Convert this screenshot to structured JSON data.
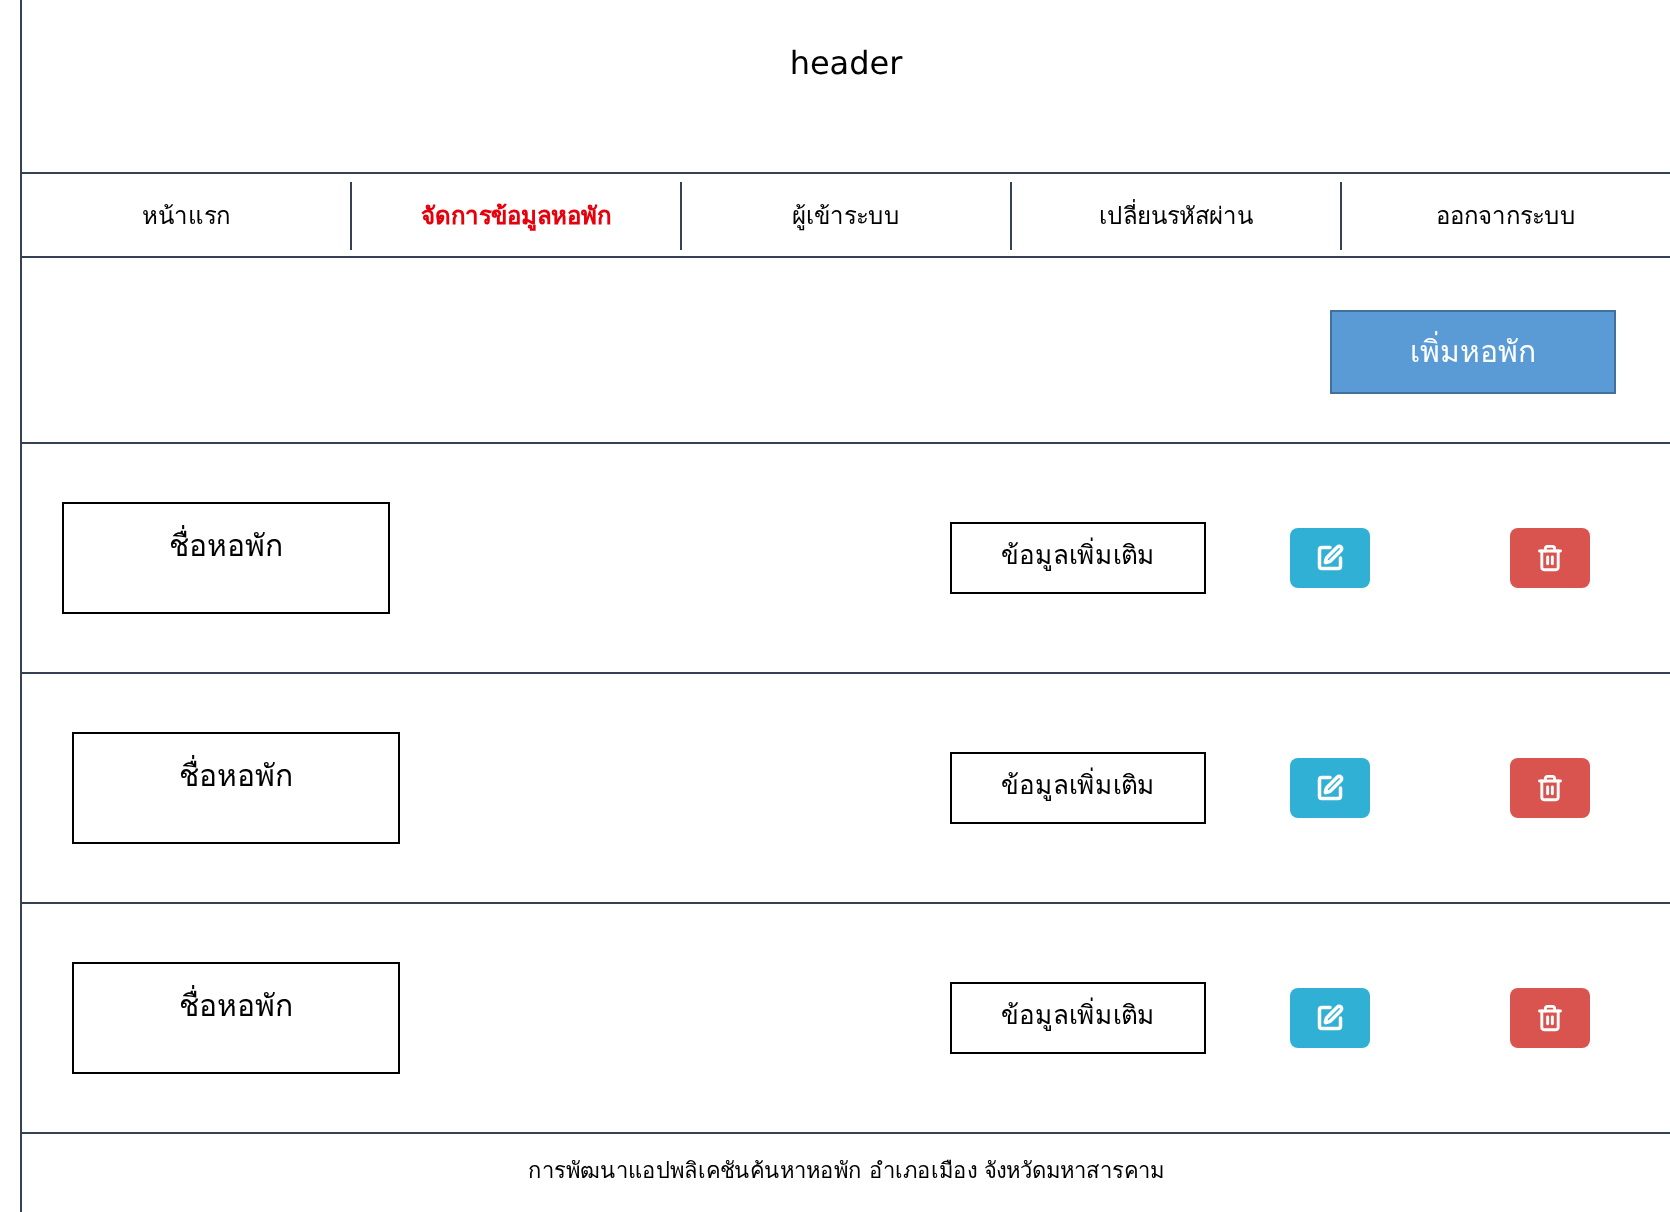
{
  "header": {
    "title": "header"
  },
  "nav": [
    {
      "label": "หน้าแรก",
      "selected": false
    },
    {
      "label": "จัดการข้อมูลหอพัก",
      "selected": true
    },
    {
      "label": "ผู้เข้าระบบ",
      "selected": false
    },
    {
      "label": "เปลี่ยนรหัสผ่าน",
      "selected": false
    },
    {
      "label": "ออกจากระบบ",
      "selected": false
    }
  ],
  "add_button": "เพิ่มหอพัก",
  "dorms": [
    {
      "name": "ชื่อหอพัก",
      "details_button": "ข้อมูลเพิ่มเติม"
    },
    {
      "name": "ชื่อหอพัก",
      "details_button": "ข้อมูลเพิ่มเติม"
    },
    {
      "name": "ชื่อหอพัก",
      "details_button": "ข้อมูลเพิ่มเติม"
    }
  ],
  "footer": "การพัฒนาแอปพลิเคชันค้นหาหอพัก อำเภอเมือง จังหวัดมหาสารคาม"
}
